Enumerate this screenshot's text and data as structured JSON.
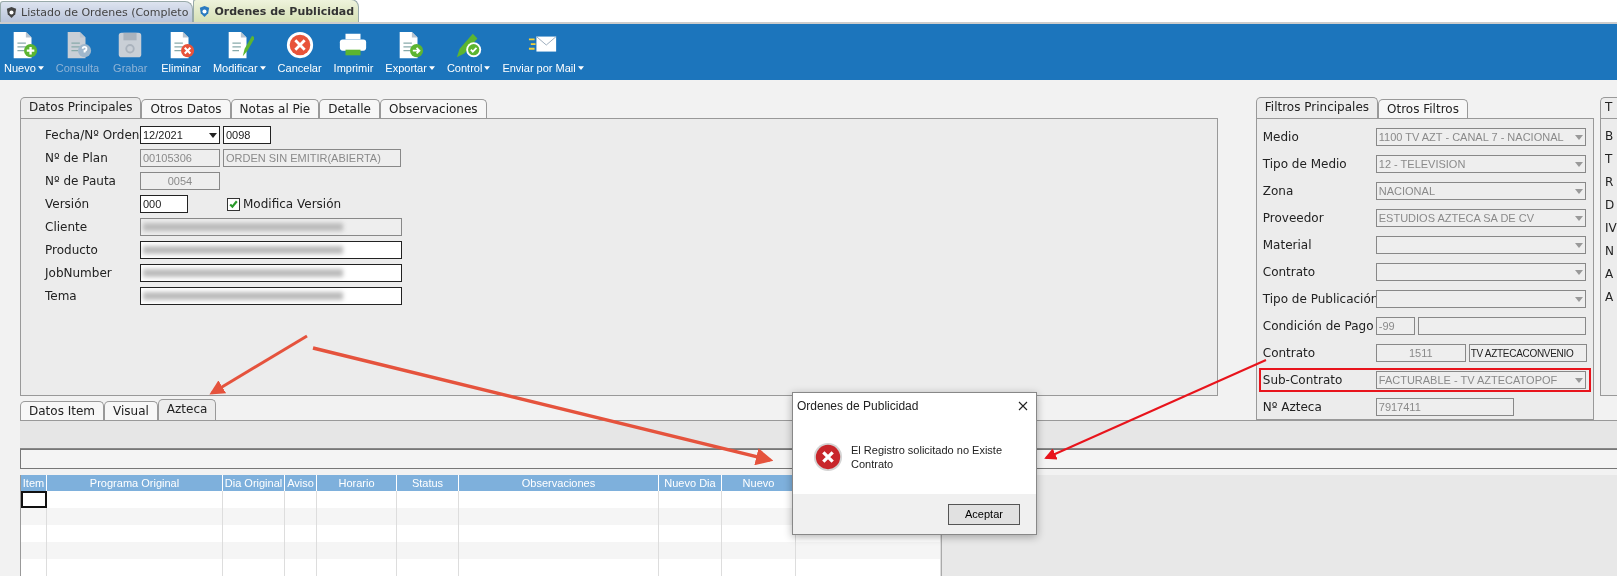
{
  "document_tabs": [
    {
      "label": "Listado de Ordenes (Completo",
      "selected": false
    },
    {
      "label": "Ordenes de Publicidad",
      "selected": true
    }
  ],
  "toolbar": [
    {
      "label": "Nuevo",
      "kind": "new",
      "menu": true,
      "disabled": false
    },
    {
      "label": "Consulta",
      "kind": "query",
      "menu": false,
      "disabled": true
    },
    {
      "label": "Grabar",
      "kind": "save",
      "menu": false,
      "disabled": true
    },
    {
      "label": "Eliminar",
      "kind": "delete",
      "menu": false,
      "disabled": false
    },
    {
      "label": "Modificar",
      "kind": "edit",
      "menu": true,
      "disabled": false
    },
    {
      "label": "Cancelar",
      "kind": "cancel",
      "menu": false,
      "disabled": false
    },
    {
      "label": "Imprimir",
      "kind": "print",
      "menu": false,
      "disabled": false
    },
    {
      "label": "Exportar",
      "kind": "export",
      "menu": true,
      "disabled": false
    },
    {
      "label": "Control",
      "kind": "control",
      "menu": true,
      "disabled": false
    },
    {
      "label": "Enviar por Mail",
      "kind": "mail",
      "menu": true,
      "disabled": false
    }
  ],
  "main_tabs": [
    {
      "label": "Datos Principales",
      "selected": true
    },
    {
      "label": "Otros Datos",
      "selected": false
    },
    {
      "label": "Notas al Pie",
      "selected": false
    },
    {
      "label": "Detalle",
      "selected": false
    },
    {
      "label": "Observaciones",
      "selected": false
    }
  ],
  "order_form": [
    {
      "kind": "order",
      "label": "Fecha/Nº Orden",
      "month": "12/2021",
      "number": "0098"
    },
    {
      "kind": "plan",
      "label": "Nº de Plan",
      "code": "00105306",
      "status": "ORDEN SIN EMITIR(ABIERTA)"
    },
    {
      "kind": "pauta",
      "label": "Nº de Pauta",
      "value": "0054"
    },
    {
      "kind": "version",
      "label": "Versión",
      "value": "000",
      "checkbox": {
        "label": "Modifica Versión",
        "checked": true
      }
    },
    {
      "kind": "redacted",
      "label": "Cliente",
      "disabled": true
    },
    {
      "kind": "redacted",
      "label": "Producto",
      "disabled": false
    },
    {
      "kind": "redacted",
      "label": "JobNumber",
      "disabled": false
    },
    {
      "kind": "redacted",
      "label": "Tema",
      "disabled": false
    }
  ],
  "filter_tabs": [
    {
      "label": "Filtros Principales",
      "selected": true
    },
    {
      "label": "Otros Filtros",
      "selected": false
    }
  ],
  "filters": [
    {
      "kind": "combo",
      "label": "Medio",
      "value": "1100 TV AZT - CANAL 7 - NACIONAL",
      "highlighted": false
    },
    {
      "kind": "combo",
      "label": "Tipo de Medio",
      "value": "12 - TELEVISION",
      "highlighted": false
    },
    {
      "kind": "combo",
      "label": "Zona",
      "value": "NACIONAL",
      "highlighted": false
    },
    {
      "kind": "combo",
      "label": "Proveedor",
      "value": "ESTUDIOS AZTECA SA DE CV",
      "highlighted": false
    },
    {
      "kind": "combo",
      "label": "Material",
      "highlighted": false
    },
    {
      "kind": "combo",
      "label": "Contrato",
      "highlighted": false
    },
    {
      "kind": "combo",
      "label": "Tipo de Publicación",
      "highlighted": false
    },
    {
      "kind": "payment",
      "label": "Condición de Pago",
      "first": "-99"
    },
    {
      "kind": "contract",
      "label": "Contrato",
      "first": "1511",
      "second": "TV AZTECACONVENIO"
    },
    {
      "kind": "combo",
      "label": "Sub-Contrato",
      "value": "FACTURABLE - TV AZTECATOPOF",
      "highlighted": true
    },
    {
      "kind": "readonly",
      "label": "Nº Azteca",
      "first": "7917411"
    }
  ],
  "side_panel": {
    "tab": "T",
    "labels": [
      "B",
      "T",
      "R",
      "D",
      "IV",
      "N",
      "A",
      "A"
    ]
  },
  "item_tabs": [
    {
      "label": "Datos Item",
      "selected": false
    },
    {
      "label": "Visual",
      "selected": false
    },
    {
      "label": "Azteca",
      "selected": true
    }
  ],
  "table": {
    "columns": [
      "Item",
      "Programa Original",
      "Dia Original",
      "Aviso",
      "Horario",
      "Status",
      "Observaciones",
      "Nuevo Dia",
      "Nuevo"
    ],
    "rows": [
      {
        "selected": true
      },
      {
        "selected": false
      },
      {
        "selected": false
      },
      {
        "selected": false
      },
      {
        "selected": false
      }
    ]
  },
  "dialog": {
    "title": "Ordenes de Publicidad",
    "message": "El Registro solicitado no Existe Contrato",
    "button": "Aceptar"
  }
}
